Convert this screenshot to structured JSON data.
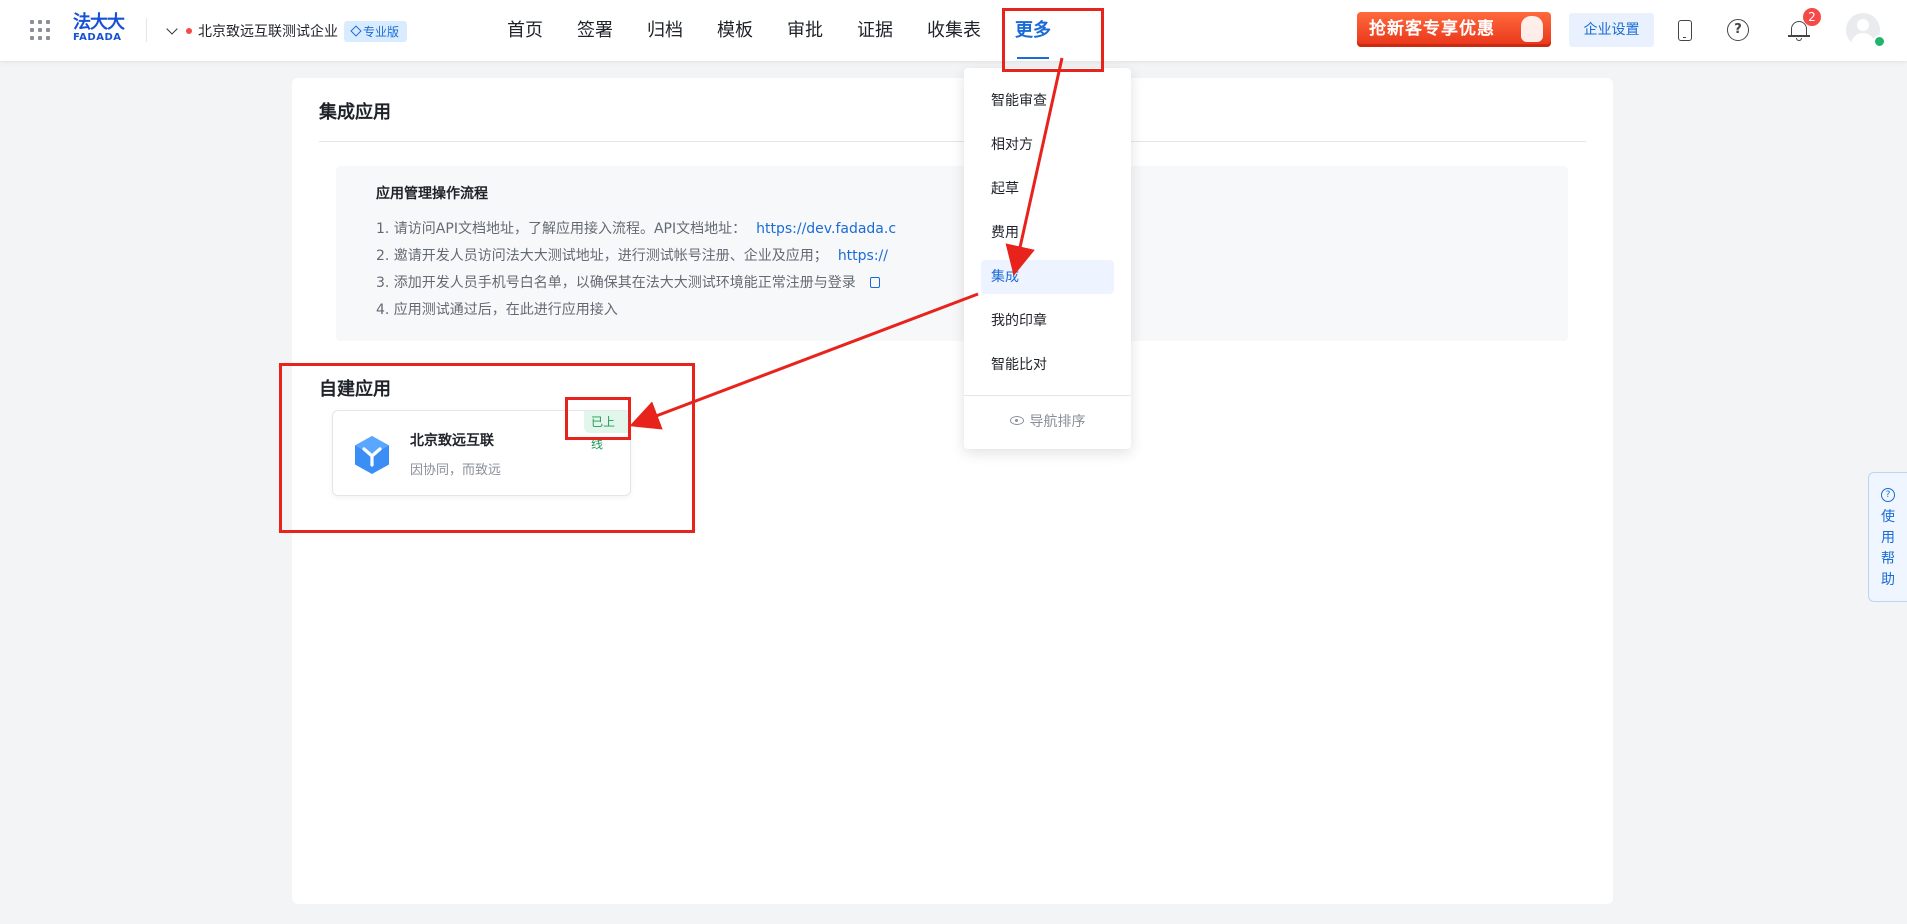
{
  "header": {
    "logo": {
      "cn": "法大大",
      "en": "FADADA"
    },
    "company_name": "北京致远互联测试企业",
    "plan_badge": "专业版",
    "nav": [
      "首页",
      "签署",
      "归档",
      "模板",
      "审批",
      "证据",
      "收集表",
      "更多"
    ],
    "active_nav": "更多",
    "promo_label": "抢新客专享优惠",
    "settings_label": "企业设置",
    "notification_count": "2"
  },
  "main": {
    "title": "集成应用",
    "guide": {
      "title": "应用管理操作流程",
      "steps": [
        {
          "text": "1. 请访问API文档地址，了解应用接入流程。API文档地址：",
          "link": "https://dev.fadada.c"
        },
        {
          "text": "2. 邀请开发人员访问法大大测试地址，进行测试帐号注册、企业及应用；",
          "link": "https://"
        },
        {
          "text": "3. 添加开发人员手机号白名单，以确保其在法大大测试环境能正常注册与登录",
          "link": ""
        },
        {
          "text": "4. 应用测试通过后，在此进行应用接入",
          "link": ""
        }
      ]
    },
    "self_built": {
      "title": "自建应用",
      "app": {
        "name": "北京致远互联",
        "desc": "因协同，而致远",
        "status": "已上线"
      }
    }
  },
  "dropdown": {
    "items": [
      "智能审查",
      "相对方",
      "起草",
      "费用",
      "集成",
      "我的印章",
      "智能比对"
    ],
    "active": "集成",
    "footer": "导航排序"
  },
  "help_tab": {
    "label": "使用帮助"
  },
  "colors": {
    "brand": "#1b6bd6",
    "annotation": "#e8231c",
    "success": "#1e9a58"
  }
}
